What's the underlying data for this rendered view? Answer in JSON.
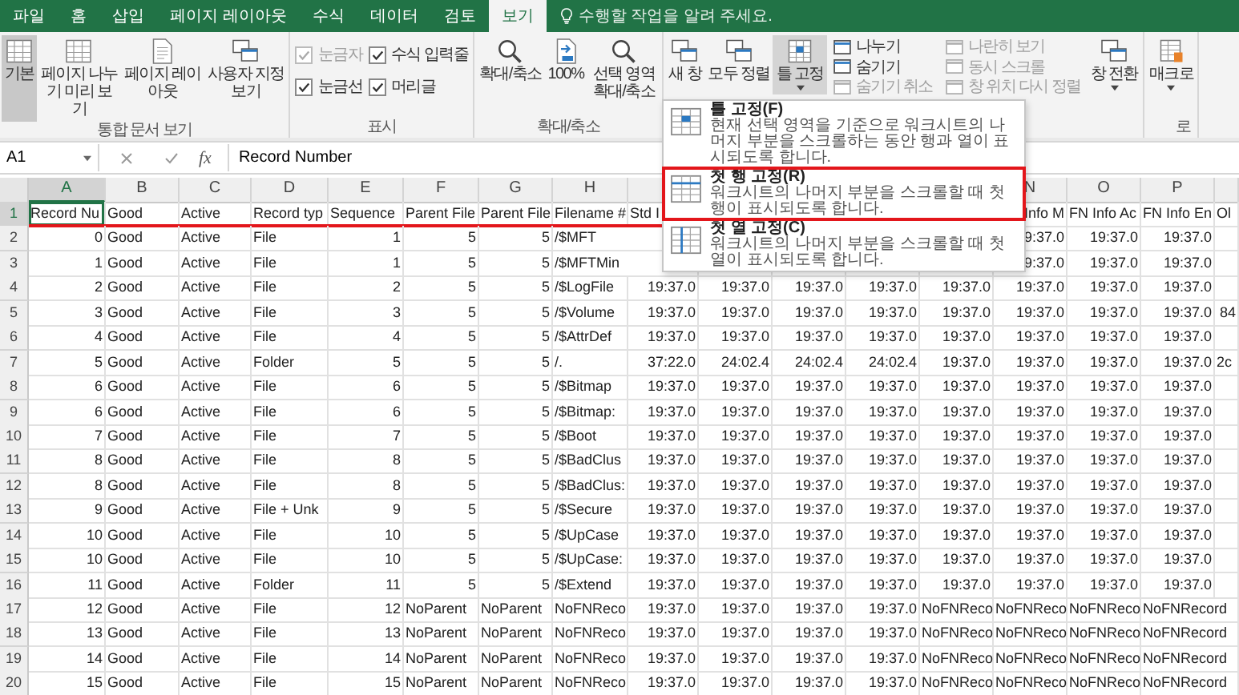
{
  "tabs": [
    {
      "label": "파일",
      "selected": false
    },
    {
      "label": "홈",
      "selected": false
    },
    {
      "label": "삽입",
      "selected": false
    },
    {
      "label": "페이지 레이아웃",
      "selected": false
    },
    {
      "label": "수식",
      "selected": false
    },
    {
      "label": "데이터",
      "selected": false
    },
    {
      "label": "검토",
      "selected": false
    },
    {
      "label": "보기",
      "selected": true
    }
  ],
  "tell_me": {
    "placeholder": "수행할 작업을 알려 주세요."
  },
  "ribbon": {
    "groups": [
      {
        "label": "통합 문서 보기",
        "items": [
          {
            "kind": "big",
            "label": "기본",
            "selected": true
          },
          {
            "kind": "big",
            "label": "페이지 나누기 미리 보기",
            "selected": false
          },
          {
            "kind": "big",
            "label": "페이지 레이아웃",
            "selected": false
          },
          {
            "kind": "big",
            "label": "사용자 지정 보기",
            "selected": false
          }
        ]
      },
      {
        "label": "표시",
        "items": [
          {
            "kind": "stack",
            "entries": [
              {
                "kind": "check",
                "label": "눈금자",
                "checked": true,
                "disabled": true
              },
              {
                "kind": "check",
                "label": "눈금선",
                "checked": true,
                "disabled": false
              }
            ]
          },
          {
            "kind": "stack",
            "entries": [
              {
                "kind": "check",
                "label": "수식 입력줄",
                "checked": true,
                "disabled": false
              },
              {
                "kind": "check",
                "label": "머리글",
                "checked": true,
                "disabled": false
              }
            ]
          }
        ]
      },
      {
        "label": "확대/축소",
        "items": [
          {
            "kind": "big",
            "label": "확대/축소"
          },
          {
            "kind": "big",
            "label": "100%"
          },
          {
            "kind": "big",
            "label": "선택 영역 확대/축소"
          }
        ]
      },
      {
        "items": [
          {
            "kind": "big",
            "label": "새 창",
            "dropdown": false,
            "expanded": false
          },
          {
            "kind": "big",
            "label": "모두 정렬",
            "dropdown": false,
            "expanded": false
          },
          {
            "kind": "big",
            "label": "틀 고정",
            "dropdown": true,
            "expanded": true
          },
          {
            "kind": "stack",
            "entries": [
              {
                "kind": "small",
                "label": "나누기",
                "disabled": false
              },
              {
                "kind": "small",
                "label": "숨기기",
                "disabled": false
              },
              {
                "kind": "small",
                "label": "숨기기 취소",
                "disabled": true
              }
            ]
          },
          {
            "kind": "stack",
            "entries": [
              {
                "kind": "small",
                "label": "나란히 보기",
                "disabled": true
              },
              {
                "kind": "small",
                "label": "동시 스크롤",
                "disabled": true
              },
              {
                "kind": "small",
                "label": "창 위치 다시 정렬",
                "disabled": true
              }
            ]
          },
          {
            "kind": "big",
            "label": "창 전환",
            "dropdown": true,
            "expanded": false
          }
        ]
      },
      {
        "label": "로",
        "items": [
          {
            "kind": "big",
            "label": "매크로",
            "dropdown": true,
            "expanded": false
          }
        ]
      }
    ]
  },
  "formula_bar": {
    "name_box": "A1",
    "function_label": "fx",
    "value": "Record Number"
  },
  "freeze_menu": {
    "items": [
      {
        "title": "틀 고정(F)",
        "description": "현재 선택 영역을 기준으로 워크시트의 나머지 부분을 스크롤하는 동안 행과 열이 표시되도록 합니다.",
        "annotated": false
      },
      {
        "title": "첫 행 고정(R)",
        "description": "워크시트의 나머지 부분을 스크롤할 때 첫 행이 표시되도록 합니다.",
        "annotated": true
      },
      {
        "title": "첫 열 고정(C)",
        "description": "워크시트의 나머지 부분을 스크롤할 때 첫 열이 표시되도록 합니다.",
        "annotated": false
      }
    ]
  },
  "sheet": {
    "columns": [
      {
        "letter": "A",
        "selected": true
      },
      {
        "letter": "B",
        "selected": false
      },
      {
        "letter": "C",
        "selected": false
      },
      {
        "letter": "D",
        "selected": false
      },
      {
        "letter": "E",
        "selected": false
      },
      {
        "letter": "F",
        "selected": false
      },
      {
        "letter": "G",
        "selected": false
      },
      {
        "letter": "H",
        "selected": false
      },
      {
        "selected": false
      },
      null,
      null,
      null,
      null,
      {
        "letter": "N",
        "selected": false
      },
      {
        "letter": "O",
        "selected": false
      },
      {
        "letter": "P",
        "selected": false
      },
      {
        "selected": false
      }
    ],
    "rows": [
      {
        "number": "1",
        "selected": true,
        "annotated": true,
        "cells": [
          "Record Nu",
          "Good",
          "Active",
          "Record typ",
          "Sequence",
          "Parent File",
          "Parent File",
          "Filename #",
          "Std I",
          null,
          null,
          null,
          null,
          "Info M",
          "FN Info Ac",
          "FN Info En",
          "Ol"
        ]
      },
      {
        "number": "2",
        "selected": false,
        "annotated": false,
        "cells": [
          "0",
          "Good",
          "Active",
          "File",
          "1",
          "5",
          "5",
          "/$MFT",
          null,
          null,
          null,
          null,
          null,
          "9:37.0",
          "19:37.0",
          "19:37.0",
          null
        ]
      },
      {
        "number": "3",
        "selected": false,
        "annotated": false,
        "cells": [
          "1",
          "Good",
          "Active",
          "File",
          "1",
          "5",
          "5",
          "/$MFTMin",
          null,
          null,
          null,
          null,
          null,
          "9:37.0",
          "19:37.0",
          "19:37.0",
          null
        ]
      },
      {
        "number": "4",
        "selected": false,
        "annotated": false,
        "cells": [
          "2",
          "Good",
          "Active",
          "File",
          "2",
          "5",
          "5",
          "/$LogFile",
          "19:37.0",
          "19:37.0",
          "19:37.0",
          "19:37.0",
          "19:37.0",
          "19:37.0",
          "19:37.0",
          "19:37.0",
          null
        ]
      },
      {
        "number": "5",
        "selected": false,
        "annotated": false,
        "cells": [
          "3",
          "Good",
          "Active",
          "File",
          "3",
          "5",
          "5",
          "/$Volume",
          "19:37.0",
          "19:37.0",
          "19:37.0",
          "19:37.0",
          "19:37.0",
          "19:37.0",
          "19:37.0",
          "19:37.0",
          "84"
        ]
      },
      {
        "number": "6",
        "selected": false,
        "annotated": false,
        "cells": [
          "4",
          "Good",
          "Active",
          "File",
          "4",
          "5",
          "5",
          "/$AttrDef",
          "19:37.0",
          "19:37.0",
          "19:37.0",
          "19:37.0",
          "19:37.0",
          "19:37.0",
          "19:37.0",
          "19:37.0",
          null
        ]
      },
      {
        "number": "7",
        "selected": false,
        "annotated": false,
        "cells": [
          "5",
          "Good",
          "Active",
          "Folder",
          "5",
          "5",
          "5",
          "/.",
          "37:22.0",
          "24:02.4",
          "24:02.4",
          "24:02.4",
          "19:37.0",
          "19:37.0",
          "19:37.0",
          "19:37.0",
          "2c"
        ]
      },
      {
        "number": "8",
        "selected": false,
        "annotated": false,
        "cells": [
          "6",
          "Good",
          "Active",
          "File",
          "6",
          "5",
          "5",
          "/$Bitmap",
          "19:37.0",
          "19:37.0",
          "19:37.0",
          "19:37.0",
          "19:37.0",
          "19:37.0",
          "19:37.0",
          "19:37.0",
          null
        ]
      },
      {
        "number": "9",
        "selected": false,
        "annotated": false,
        "cells": [
          "6",
          "Good",
          "Active",
          "File",
          "6",
          "5",
          "5",
          "/$Bitmap:",
          "19:37.0",
          "19:37.0",
          "19:37.0",
          "19:37.0",
          "19:37.0",
          "19:37.0",
          "19:37.0",
          "19:37.0",
          null
        ]
      },
      {
        "number": "10",
        "selected": false,
        "annotated": false,
        "cells": [
          "7",
          "Good",
          "Active",
          "File",
          "7",
          "5",
          "5",
          "/$Boot",
          "19:37.0",
          "19:37.0",
          "19:37.0",
          "19:37.0",
          "19:37.0",
          "19:37.0",
          "19:37.0",
          "19:37.0",
          null
        ]
      },
      {
        "number": "11",
        "selected": false,
        "annotated": false,
        "cells": [
          "8",
          "Good",
          "Active",
          "File",
          "8",
          "5",
          "5",
          "/$BadClus",
          "19:37.0",
          "19:37.0",
          "19:37.0",
          "19:37.0",
          "19:37.0",
          "19:37.0",
          "19:37.0",
          "19:37.0",
          null
        ]
      },
      {
        "number": "12",
        "selected": false,
        "annotated": false,
        "cells": [
          "8",
          "Good",
          "Active",
          "File",
          "8",
          "5",
          "5",
          "/$BadClus:",
          "19:37.0",
          "19:37.0",
          "19:37.0",
          "19:37.0",
          "19:37.0",
          "19:37.0",
          "19:37.0",
          "19:37.0",
          null
        ]
      },
      {
        "number": "13",
        "selected": false,
        "annotated": false,
        "cells": [
          "9",
          "Good",
          "Active",
          "File + Unk",
          "9",
          "5",
          "5",
          "/$Secure",
          "19:37.0",
          "19:37.0",
          "19:37.0",
          "19:37.0",
          "19:37.0",
          "19:37.0",
          "19:37.0",
          "19:37.0",
          null
        ]
      },
      {
        "number": "14",
        "selected": false,
        "annotated": false,
        "cells": [
          "10",
          "Good",
          "Active",
          "File",
          "10",
          "5",
          "5",
          "/$UpCase",
          "19:37.0",
          "19:37.0",
          "19:37.0",
          "19:37.0",
          "19:37.0",
          "19:37.0",
          "19:37.0",
          "19:37.0",
          null
        ]
      },
      {
        "number": "15",
        "selected": false,
        "annotated": false,
        "cells": [
          "10",
          "Good",
          "Active",
          "File",
          "10",
          "5",
          "5",
          "/$UpCase:",
          "19:37.0",
          "19:37.0",
          "19:37.0",
          "19:37.0",
          "19:37.0",
          "19:37.0",
          "19:37.0",
          "19:37.0",
          null
        ]
      },
      {
        "number": "16",
        "selected": false,
        "annotated": false,
        "cells": [
          "11",
          "Good",
          "Active",
          "Folder",
          "11",
          "5",
          "5",
          "/$Extend",
          "19:37.0",
          "19:37.0",
          "19:37.0",
          "19:37.0",
          "19:37.0",
          "19:37.0",
          "19:37.0",
          "19:37.0",
          null
        ]
      },
      {
        "number": "17",
        "selected": false,
        "annotated": false,
        "cells": [
          "12",
          "Good",
          "Active",
          "File",
          "12",
          "NoParent",
          "NoParent",
          "NoFNReco",
          "19:37.0",
          "19:37.0",
          "19:37.0",
          "19:37.0",
          "NoFNReco",
          "NoFNReco",
          "NoFNReco",
          "NoFNRecord",
          null
        ]
      },
      {
        "number": "18",
        "selected": false,
        "annotated": false,
        "cells": [
          "13",
          "Good",
          "Active",
          "File",
          "13",
          "NoParent",
          "NoParent",
          "NoFNReco",
          "19:37.0",
          "19:37.0",
          "19:37.0",
          "19:37.0",
          "NoFNReco",
          "NoFNReco",
          "NoFNReco",
          "NoFNRecord",
          null
        ]
      },
      {
        "number": "19",
        "selected": false,
        "annotated": false,
        "cells": [
          "14",
          "Good",
          "Active",
          "File",
          "14",
          "NoParent",
          "NoParent",
          "NoFNReco",
          "19:37.0",
          "19:37.0",
          "19:37.0",
          "19:37.0",
          "NoFNReco",
          "NoFNReco",
          "NoFNReco",
          "NoFNRecord",
          null
        ]
      },
      {
        "number": "20",
        "selected": false,
        "annotated": false,
        "cells": [
          "15",
          "Good",
          "Active",
          "File",
          "15",
          "NoParent",
          "NoParent",
          "NoFNReco",
          "19:37.0",
          "19:37.0",
          "19:37.0",
          "19:37.0",
          "NoFNReco",
          "NoFNReco",
          "NoFNReco",
          "NoFNRecord",
          null
        ]
      }
    ]
  }
}
